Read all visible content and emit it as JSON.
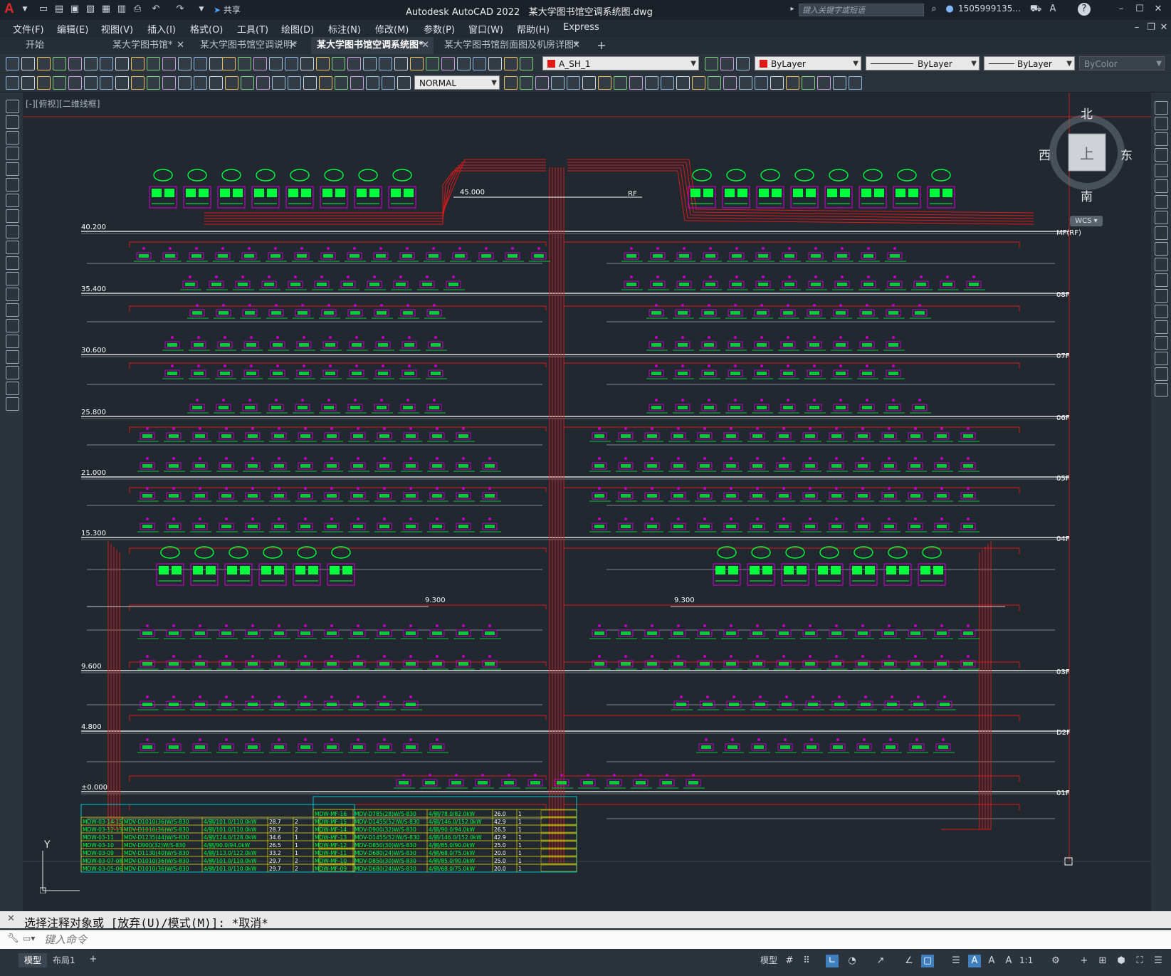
{
  "titlebar": {
    "app_title": "Autodesk AutoCAD 2022",
    "file_title": "某大学图书馆空调系统图.dwg",
    "share_label": "共享",
    "search_placeholder": "键入关键字或短语",
    "user": "1505999135..."
  },
  "menu": [
    "文件(F)",
    "编辑(E)",
    "视图(V)",
    "插入(I)",
    "格式(O)",
    "工具(T)",
    "绘图(D)",
    "标注(N)",
    "修改(M)",
    "参数(P)",
    "窗口(W)",
    "帮助(H)",
    "Express"
  ],
  "tabs": [
    {
      "label": "开始",
      "active": false,
      "closable": false
    },
    {
      "label": "某大学图书馆*",
      "active": false,
      "closable": true
    },
    {
      "label": "某大学图书馆空调说明*",
      "active": false,
      "closable": true
    },
    {
      "label": "某大学图书馆空调系统图*",
      "active": true,
      "closable": true
    },
    {
      "label": "某大学图书馆剖面图及机房详图*",
      "active": false,
      "closable": true
    }
  ],
  "toolbar": {
    "layer_name": "A_SH_1",
    "color": "ByLayer",
    "linetype": "ByLayer",
    "lineweight": "ByLayer",
    "plotstyle": "ByColor",
    "dimstyle": "NORMAL"
  },
  "viewport": {
    "view_label": "[-][俯视][二维线框]",
    "compass": {
      "north": "北",
      "south": "南",
      "east": "东",
      "west": "西",
      "top": "上",
      "wcs": "WCS"
    },
    "ucs_y": "Y"
  },
  "drawing": {
    "elevations": [
      {
        "text": "40.200",
        "floor": "MF(RF)"
      },
      {
        "text": "35.400",
        "floor": "08F"
      },
      {
        "text": "30.600",
        "floor": "07F"
      },
      {
        "text": "25.800",
        "floor": "06F"
      },
      {
        "text": "21.000",
        "floor": "05F"
      },
      {
        "text": "15.300",
        "floor": "04F"
      },
      {
        "text": "9.600",
        "floor": "03F"
      },
      {
        "text": "4.800",
        "floor": "D2F"
      },
      {
        "text": "±0.000",
        "floor": "01F"
      }
    ],
    "roof_labels": {
      "elev": "45.000",
      "rf": "RF"
    },
    "mid_labels": [
      "9.300",
      "9.300"
    ],
    "table_left": [
      [
        "MDW-03-14-15",
        "MDV-D1010(36)W/S-830",
        "4/铜/101.0/110.0kW",
        "28.7",
        "2"
      ],
      [
        "MDW-03-12-13",
        "MDV-D1010(36)W/S-830",
        "4/铜/101.0/110.0kW",
        "28.7",
        "2"
      ],
      [
        "MDW-03-11",
        "MDV-D1235(44)W/S-830",
        "4/铜/124.0/128.0kW",
        "34.6",
        "1"
      ],
      [
        "MDW-03-10",
        "MDV-D900(32)W/S-830",
        "4/铜/90.0/94.0kW",
        "26.5",
        "1"
      ],
      [
        "MDW-03-09",
        "MDV-D1130(40)W/S-830",
        "4/铜/113.0/122.0kW",
        "33.2",
        "1"
      ],
      [
        "MDW-03-07-08",
        "MDV-D1010(36)W/S-830",
        "4/铜/101.0/110.0kW",
        "29.7",
        "2"
      ],
      [
        "MDW-03-05-06",
        "MDV-D1010(36)W/S-830",
        "4/铜/101.0/110.0kW",
        "29.7",
        "2"
      ]
    ],
    "table_right": [
      [
        "MDW-MF-16",
        "MDV-D785(28)W/S-830",
        "4/铜/78.0/82.0kW",
        "26.0",
        "1"
      ],
      [
        "MDW-MF-15",
        "MDV-D1455(52)W/S-830",
        "4/铜/146.0/152.0kW",
        "42.9",
        "1"
      ],
      [
        "MDW-MF-14",
        "MDV-D900(32)W/S-830",
        "4/铜/90.0/94.0kW",
        "26.5",
        "1"
      ],
      [
        "MDW-MF-13",
        "MDV-D1455(52)W/S-830",
        "4/铜/146.0/152.0kW",
        "42.9",
        "1"
      ],
      [
        "MDW-MF-12",
        "MDV-D850(30)W/S-830",
        "4/铜/85.0/90.0kW",
        "25.0",
        "1"
      ],
      [
        "MDW-MF-11",
        "MDV-D680(24)W/S-830",
        "4/铜/68.0/75.0kW",
        "20.0",
        "1"
      ],
      [
        "MDW-MF-10",
        "MDV-D850(30)W/S-830",
        "4/铜/85.0/90.0kW",
        "25.0",
        "1"
      ],
      [
        "MDW-MF-09",
        "MDV-D680(24)W/S-830",
        "4/铜/68.0/75.0kW",
        "20.0",
        "1"
      ]
    ]
  },
  "command": {
    "history": "选择注释对象或 [放弃(U)/模式(M)]: *取消*",
    "placeholder": "键入命令"
  },
  "status": {
    "tabs": [
      "模型",
      "布局1"
    ],
    "model_label": "模型",
    "scale": "1:1"
  },
  "colors": {
    "canvas_bg": "#212830",
    "pipe_red": "#e01818",
    "unit_green": "#00ff3c",
    "unit_magenta": "#c000c0",
    "floor_line": "#ffffff",
    "table_cyan": "#00c8c8",
    "table_yellow": "#e8e000"
  }
}
